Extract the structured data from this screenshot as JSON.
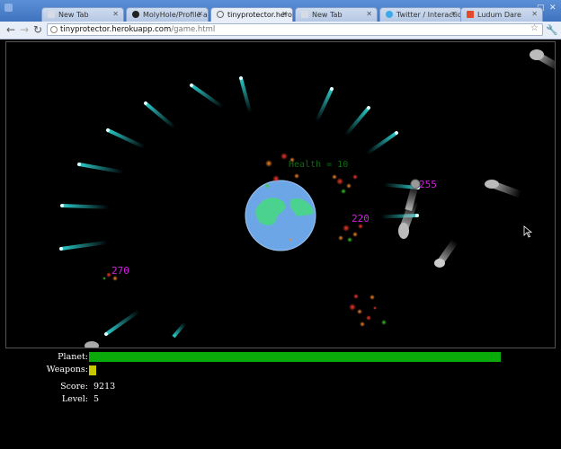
{
  "tabs": [
    {
      "label": "New Tab",
      "icon": "page-icon",
      "active": false
    },
    {
      "label": "MolyHole/Profile at",
      "icon": "github-icon",
      "active": false
    },
    {
      "label": "tinyprotector.heroku",
      "icon": "globe-icon",
      "active": true
    },
    {
      "label": "New Tab",
      "icon": "page-icon",
      "active": false
    },
    {
      "label": "Twitter / Interactions",
      "icon": "twitter-icon",
      "active": false
    },
    {
      "label": "Ludum Dare",
      "icon": "ludum-dare-icon",
      "active": false
    }
  ],
  "address": {
    "host": "tinyprotector.herokuapp.com",
    "path": "/game.html"
  },
  "game": {
    "health_label": "Health = 10",
    "damage_texts": [
      "255",
      "220",
      "270"
    ],
    "colors": {
      "beam": "#2fd6d6",
      "planet_ocean": "#6da6e6",
      "planet_land": "#4ad28e",
      "damage": "#d21ee0",
      "health": "#0f6a0f"
    }
  },
  "hud": {
    "planet_label": "Planet:",
    "weapons_label": "Weapons:",
    "score_label": "Score:",
    "score_value": "9213",
    "level_label": "Level:",
    "level_value": "5",
    "planet_level": 1.0,
    "weapons_level": 0.017,
    "planet_color": "#0aaa0a",
    "weapons_color": "#c8c800"
  }
}
